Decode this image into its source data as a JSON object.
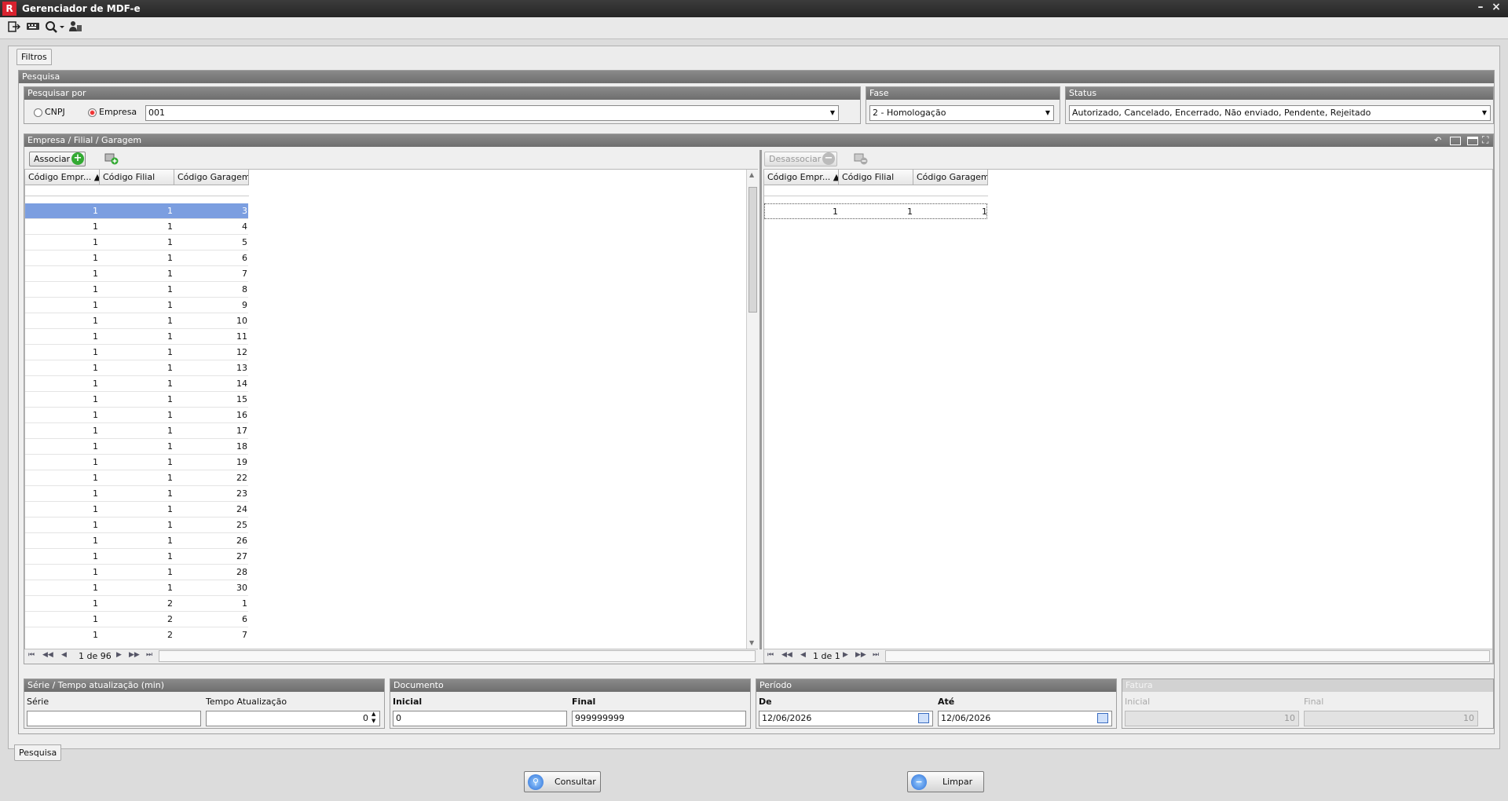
{
  "window": {
    "title": "Gerenciador de MDF-e",
    "logo_glyph": "R",
    "minimize": "–",
    "close": "×"
  },
  "toolbar": {
    "icons": [
      "exit-icon",
      "keyboard-icon",
      "search-icon",
      "user-icon"
    ]
  },
  "tabs": {
    "filters": "Filtros",
    "bottom": "Pesquisa"
  },
  "search": {
    "section_title": "Pesquisa",
    "search_by": {
      "title": "Pesquisar por",
      "cnpj_label": "CNPJ",
      "empresa_label": "Empresa",
      "selected": "Empresa",
      "empresa_value": "001"
    },
    "fase": {
      "title": "Fase",
      "value": "2 - Homologação"
    },
    "status": {
      "title": "Status",
      "value": "Autorizado, Cancelado, Encerrado, Não enviado, Pendente, Rejeitado"
    }
  },
  "association": {
    "title": "Empresa / Filial / Garagem",
    "associate_label": "Associar",
    "disassociate_label": "Desassociar",
    "columns": [
      "Código Empr...",
      "Código Filial",
      "Código Garagem"
    ],
    "left_rows": [
      [
        "1",
        "1",
        "3"
      ],
      [
        "1",
        "1",
        "4"
      ],
      [
        "1",
        "1",
        "5"
      ],
      [
        "1",
        "1",
        "6"
      ],
      [
        "1",
        "1",
        "7"
      ],
      [
        "1",
        "1",
        "8"
      ],
      [
        "1",
        "1",
        "9"
      ],
      [
        "1",
        "1",
        "10"
      ],
      [
        "1",
        "1",
        "11"
      ],
      [
        "1",
        "1",
        "12"
      ],
      [
        "1",
        "1",
        "13"
      ],
      [
        "1",
        "1",
        "14"
      ],
      [
        "1",
        "1",
        "15"
      ],
      [
        "1",
        "1",
        "16"
      ],
      [
        "1",
        "1",
        "17"
      ],
      [
        "1",
        "1",
        "18"
      ],
      [
        "1",
        "1",
        "19"
      ],
      [
        "1",
        "1",
        "22"
      ],
      [
        "1",
        "1",
        "23"
      ],
      [
        "1",
        "1",
        "24"
      ],
      [
        "1",
        "1",
        "25"
      ],
      [
        "1",
        "1",
        "26"
      ],
      [
        "1",
        "1",
        "27"
      ],
      [
        "1",
        "1",
        "28"
      ],
      [
        "1",
        "1",
        "30"
      ],
      [
        "1",
        "2",
        "1"
      ],
      [
        "1",
        "2",
        "6"
      ],
      [
        "1",
        "2",
        "7"
      ]
    ],
    "right_rows": [
      [
        "1",
        "1",
        "1"
      ]
    ],
    "left_pager": "1 de 96",
    "right_pager": "1 de 1"
  },
  "serie": {
    "title": "Série / Tempo atualização (min)",
    "serie_label": "Série",
    "serie_value": "",
    "tempo_label": "Tempo Atualização",
    "tempo_value": "0"
  },
  "documento": {
    "title": "Documento",
    "inicial_label": "Inicial",
    "inicial_value": "0",
    "final_label": "Final",
    "final_value": "999999999"
  },
  "periodo": {
    "title": "Período",
    "de_label": "De",
    "de_value": "12/06/2026",
    "ate_label": "Até",
    "ate_value": "12/06/2026"
  },
  "fatura": {
    "title": "Fatura",
    "inicial_label": "Inicial",
    "inicial_value": "10",
    "final_label": "Final",
    "final_value": "10"
  },
  "actions": {
    "consultar": "Consultar",
    "limpar": "Limpar"
  },
  "colors": {
    "selected_row": "#7b9ee0",
    "header_bg": "#7c7c7c",
    "accent_red": "#d8222e"
  }
}
